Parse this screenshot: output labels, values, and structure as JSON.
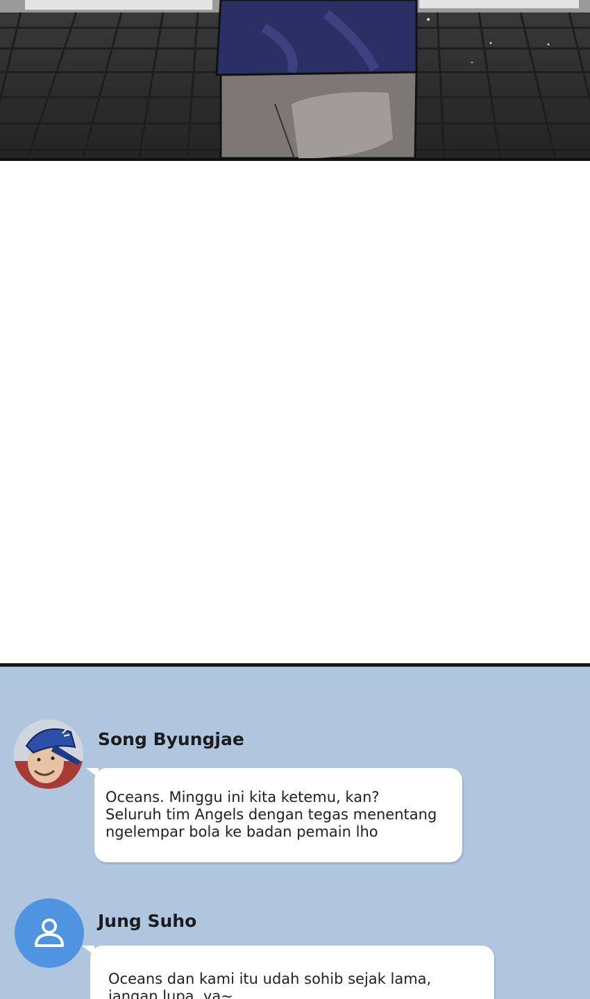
{
  "chat": {
    "messages": [
      {
        "sender": "Song Byungjae",
        "avatar": "profile-photo-blue-cap",
        "lines": [
          "Oceans. Minggu ini kita ketemu, kan?",
          "Seluruh tim Angels dengan tegas menentang",
          "ngelempar bola ke badan pemain lho"
        ]
      },
      {
        "sender": "Jung Suho",
        "avatar": "default-user-icon",
        "lines": [
          "Oceans dan kami itu udah sohib sejak lama,",
          "jangan lupa, ya~"
        ]
      }
    ]
  },
  "colors": {
    "chat_background": "#b0c6de",
    "default_avatar": "#4f94e0",
    "bubble": "#ffffff"
  }
}
